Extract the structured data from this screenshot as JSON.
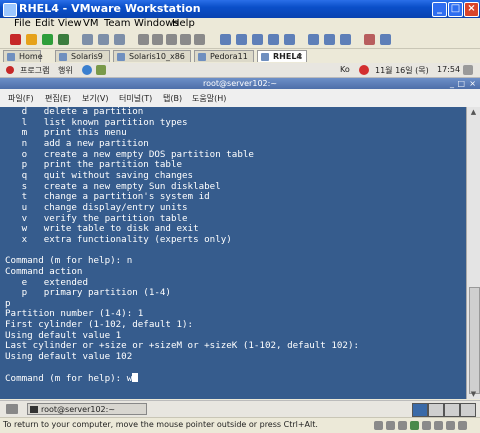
{
  "window": {
    "title": "RHEL4 - VMware Workstation"
  },
  "menubar": [
    "File",
    "Edit",
    "View",
    "VM",
    "Team",
    "Windows",
    "Help"
  ],
  "tabs": [
    {
      "label": "Home",
      "active": false
    },
    {
      "label": "Solaris9",
      "active": false
    },
    {
      "label": "Solaris10_x86",
      "active": false
    },
    {
      "label": "Pedora11",
      "active": false
    },
    {
      "label": "RHEL4",
      "active": true
    }
  ],
  "guest_panel": {
    "programs": "프로그램",
    "actions": "행위",
    "keyboard_indicator": "Ko",
    "date": "11월 16일 (목)",
    "time": "17:54"
  },
  "terminal": {
    "title": "root@server102:~",
    "menus": [
      "파일(F)",
      "편집(E)",
      "보기(V)",
      "터미널(T)",
      "탭(B)",
      "도움말(H)"
    ],
    "lines": [
      "   d   delete a partition",
      "   l   list known partition types",
      "   m   print this menu",
      "   n   add a new partition",
      "   o   create a new empty DOS partition table",
      "   p   print the partition table",
      "   q   quit without saving changes",
      "   s   create a new empty Sun disklabel",
      "   t   change a partition's system id",
      "   u   change display/entry units",
      "   v   verify the partition table",
      "   w   write table to disk and exit",
      "   x   extra functionality (experts only)",
      "",
      "Command (m for help): n",
      "Command action",
      "   e   extended",
      "   p   primary partition (1-4)",
      "p",
      "Partition number (1-4): 1",
      "First cylinder (1-102, default 1):",
      "Using default value 1",
      "Last cylinder or +size or +sizeM or +sizeK (1-102, default 102):",
      "Using default value 102",
      ""
    ],
    "prompt": "Command (m for help): w"
  },
  "taskbar": {
    "item": "root@server102:~"
  },
  "statusbar": {
    "message": "To return to your computer, move the mouse pointer outside or press Ctrl+Alt."
  }
}
